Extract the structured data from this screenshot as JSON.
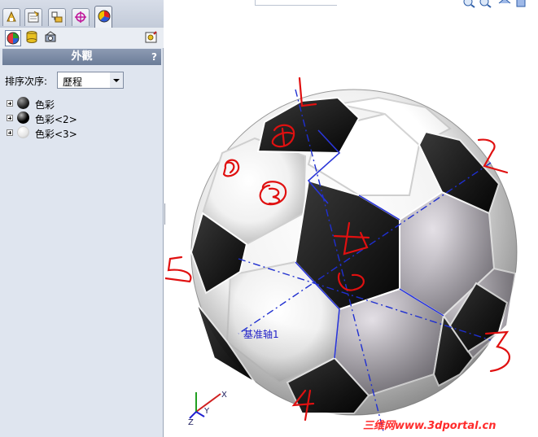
{
  "panel": {
    "section_title": "外觀",
    "help": "?",
    "sort_label": "排序次序:",
    "sort_value": "歷程",
    "items": [
      {
        "label": "色彩",
        "swatch": "#202020"
      },
      {
        "label": "色彩<2>",
        "swatch": "#000000"
      },
      {
        "label": "色彩<3>",
        "swatch": "#ffffff"
      }
    ],
    "tabs": [
      "feature-manager",
      "property-manager",
      "configuration-manager",
      "dimxpert-manager",
      "display-manager"
    ],
    "active_tab": "display-manager"
  },
  "viewport": {
    "axis_label": "基准轴1",
    "annotations": [
      "1",
      "2",
      "3",
      "4",
      "5",
      "6"
    ],
    "triad_labels": {
      "x": "X",
      "y": "Y",
      "z": "Z"
    },
    "watermark": "三维网www.3dportal.cn"
  },
  "colors": {
    "panel_bg": "#dfe5ef",
    "header_bg": "#7b8aa5",
    "annotation_red": "#e01010",
    "axis_blue": "#1f2fd0"
  }
}
